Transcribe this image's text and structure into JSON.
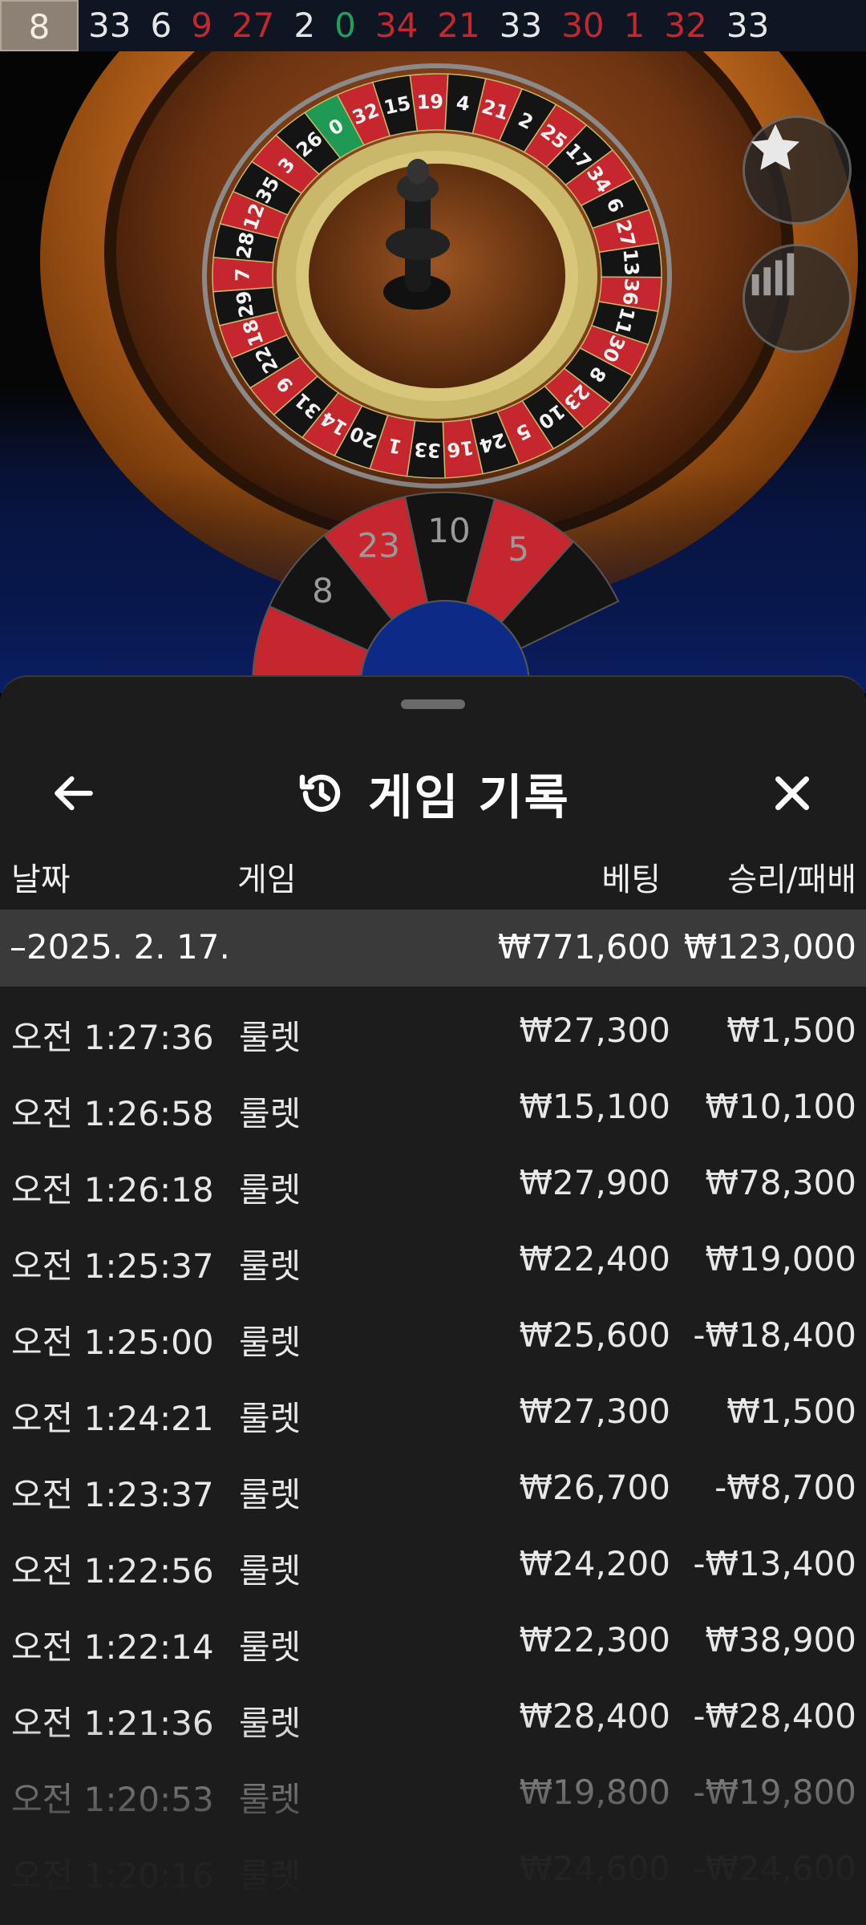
{
  "results": [
    {
      "n": "8",
      "color": "black"
    },
    {
      "n": "33",
      "color": "black"
    },
    {
      "n": "6",
      "color": "black"
    },
    {
      "n": "9",
      "color": "red"
    },
    {
      "n": "27",
      "color": "red"
    },
    {
      "n": "2",
      "color": "black"
    },
    {
      "n": "0",
      "color": "green"
    },
    {
      "n": "34",
      "color": "red"
    },
    {
      "n": "21",
      "color": "red"
    },
    {
      "n": "33",
      "color": "black"
    },
    {
      "n": "30",
      "color": "red"
    },
    {
      "n": "1",
      "color": "red"
    },
    {
      "n": "32",
      "color": "red"
    },
    {
      "n": "33",
      "color": "black"
    }
  ],
  "wheel_numbers": [
    "0",
    "32",
    "15",
    "19",
    "4",
    "21",
    "2",
    "25",
    "17",
    "34",
    "6",
    "27",
    "13",
    "36",
    "11",
    "30",
    "8",
    "23",
    "10",
    "5",
    "24",
    "16",
    "33",
    "1",
    "20",
    "14",
    "31",
    "9",
    "22",
    "18",
    "29",
    "7",
    "28",
    "12",
    "35",
    "3",
    "26"
  ],
  "racetrack_numbers": [
    "8",
    "23",
    "10",
    "5"
  ],
  "colors": {
    "red": "#c6262e",
    "black": "#141414",
    "green": "#1e9a55",
    "sheet": "#1c1c1c",
    "highlight": "#3a3a3a"
  },
  "icons": {
    "favorite": "star-icon",
    "statistics": "bar-chart-icon",
    "back": "arrow-left-icon",
    "history": "history-icon",
    "close": "close-icon"
  },
  "sheet": {
    "title": "게임 기록",
    "columns": {
      "date": "날짜",
      "game": "게임",
      "bet": "베팅",
      "result": "승리/패배"
    },
    "date_group": {
      "date": "–2025. 2. 17.",
      "total_bet": "₩771,600",
      "total_result": "₩123,000"
    },
    "rows": [
      {
        "time": "오전 1:27:36",
        "game": "룰렛",
        "bet": "₩27,300",
        "result": "₩1,500"
      },
      {
        "time": "오전 1:26:58",
        "game": "룰렛",
        "bet": "₩15,100",
        "result": "₩10,100"
      },
      {
        "time": "오전 1:26:18",
        "game": "룰렛",
        "bet": "₩27,900",
        "result": "₩78,300"
      },
      {
        "time": "오전 1:25:37",
        "game": "룰렛",
        "bet": "₩22,400",
        "result": "₩19,000"
      },
      {
        "time": "오전 1:25:00",
        "game": "룰렛",
        "bet": "₩25,600",
        "result": "-₩18,400"
      },
      {
        "time": "오전 1:24:21",
        "game": "룰렛",
        "bet": "₩27,300",
        "result": "₩1,500"
      },
      {
        "time": "오전 1:23:37",
        "game": "룰렛",
        "bet": "₩26,700",
        "result": "-₩8,700"
      },
      {
        "time": "오전 1:22:56",
        "game": "룰렛",
        "bet": "₩24,200",
        "result": "-₩13,400"
      },
      {
        "time": "오전 1:22:14",
        "game": "룰렛",
        "bet": "₩22,300",
        "result": "₩38,900"
      },
      {
        "time": "오전 1:21:36",
        "game": "룰렛",
        "bet": "₩28,400",
        "result": "-₩28,400"
      },
      {
        "time": "오전 1:20:53",
        "game": "룰렛",
        "bet": "₩19,800",
        "result": "-₩19,800"
      },
      {
        "time": "오전 1:20:16",
        "game": "룰렛",
        "bet": "₩24,600",
        "result": "-₩24,600"
      }
    ]
  }
}
